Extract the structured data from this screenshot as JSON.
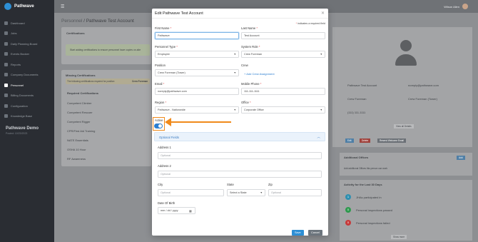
{
  "sidebar": {
    "brand": "Pathwave",
    "items": [
      {
        "label": "Dashboard",
        "active": false
      },
      {
        "label": "Jobs",
        "active": false
      },
      {
        "label": "Daily Planning Board",
        "active": false
      },
      {
        "label": "Events Booker",
        "active": false
      },
      {
        "label": "Reports",
        "active": false
      },
      {
        "label": "Company Documents",
        "active": false
      },
      {
        "label": "Personnel",
        "active": true
      },
      {
        "label": "Billing Documents",
        "active": false
      },
      {
        "label": "Configuration",
        "active": false
      },
      {
        "label": "Knowledge Base",
        "active": false
      }
    ],
    "footer_title": "Pathwave Demo",
    "footer_sub": "Posted: 10/23/2023"
  },
  "topbar": {
    "user": "Wilson Allen"
  },
  "background": {
    "breadcrumb_root": "Personnel",
    "breadcrumb_current": "Pathwave Test Account",
    "certifications_title": "Certifications",
    "cert_banner": "Start adding certifications to ensure personnel have copies on-site",
    "missing_title": "Missing Certifications",
    "missing_text": "The following certifications required for position",
    "missing_link": "Crew Foreman",
    "required_title": "Required Certifications",
    "required_items": [
      "Competent Climber",
      "Competent Rescuer",
      "Competent Rigger",
      "CPR/First Aid Training",
      "NATE Essentials",
      "OSHA 10 Hour",
      "RF Awareness"
    ],
    "profile": {
      "name": "Pathwave Test Account",
      "email": "noreply@pathwave.com",
      "role": "Crew Foreman",
      "position": "Crew Foreman (Tower)",
      "phone": "(111) 111-1111"
    },
    "view_all": "View all Details",
    "actions": [
      "Edit",
      "Delete",
      "Resend Welcome Email"
    ],
    "additional_offices": "Additional Offices",
    "additional_offices_text": "Add additional Offices this person can work",
    "add_label": "Add",
    "activity_title": "Activity for the Last 30 Days",
    "activity": [
      {
        "count": "1",
        "label": "JHAs participated in",
        "color": "#2e8fb0"
      },
      {
        "count": "0",
        "label": "Personal inspections passed",
        "color": "#2e9a4e"
      },
      {
        "count": "0",
        "label": "Personal inspections failed",
        "color": "#c63a3a"
      }
    ],
    "show_more": "Show more"
  },
  "modal": {
    "title": "Edit Pathwave Test Account",
    "required_note": "indicates a required field",
    "first_name": {
      "label": "First Name",
      "value": "Pathwave"
    },
    "last_name": {
      "label": "Last Name",
      "value": "Test Account"
    },
    "personnel_type": {
      "label": "Personnel Type",
      "value": "Employee"
    },
    "system_role": {
      "label": "System Role",
      "value": "Crew Foreman"
    },
    "position": {
      "label": "Position",
      "value": "Crew Foreman (Tower)"
    },
    "crew": {
      "label": "Crew",
      "add": "+ Add Crew Assignment"
    },
    "email": {
      "label": "Email",
      "value": "noreply@pathwave.com"
    },
    "mobile": {
      "label": "Mobile Phone",
      "value": "111-111-1111"
    },
    "region": {
      "label": "Region",
      "value": "Pathwave - Nationwide"
    },
    "office": {
      "label": "Office",
      "value": "Corporate Office"
    },
    "active": {
      "label": "Active",
      "on": true
    },
    "optional_fields": "Optional Fields",
    "address1": {
      "label": "Address 1",
      "placeholder": "Optional"
    },
    "address2": {
      "label": "Address 2",
      "placeholder": "Optional"
    },
    "city": {
      "label": "City",
      "placeholder": "Optional"
    },
    "state": {
      "label": "State",
      "value": "Select a State"
    },
    "zip": {
      "label": "Zip",
      "placeholder": "Optional"
    },
    "dob": {
      "label": "Date Of Birth",
      "placeholder": "mm / dd / yyyy"
    },
    "save": "Save",
    "cancel": "Cancel"
  },
  "colors": {
    "accent": "#2d7fd0",
    "highlight": "#f08a1c",
    "sidebar": "#2a2d33"
  }
}
